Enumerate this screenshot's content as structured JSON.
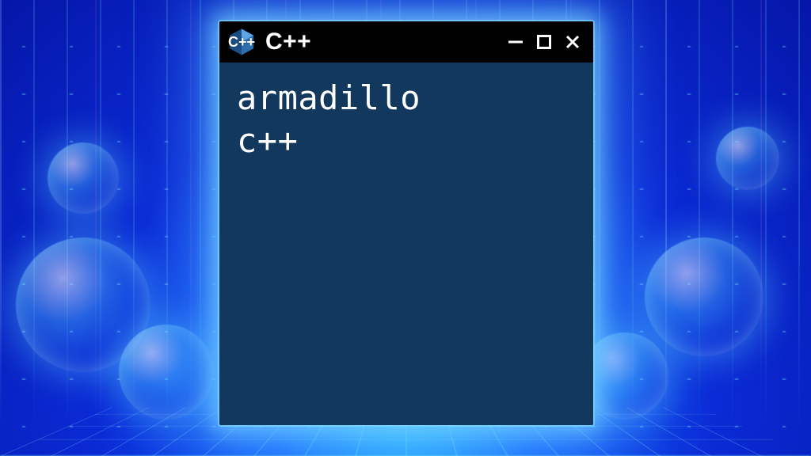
{
  "window": {
    "title": "C++",
    "icon": {
      "symbol": "C++",
      "semantic": "cpp-logo"
    },
    "controls": {
      "minimize": "minimize",
      "maximize": "maximize",
      "close": "close"
    }
  },
  "content": {
    "line1": "armadillo",
    "line2": "c++"
  },
  "colors": {
    "titlebar_bg": "#000000",
    "client_bg": "#12385e",
    "glow": "#6fd8ff",
    "text": "#ffffff",
    "badge_light": "#5aa6e6",
    "badge_dark": "#1a4e84"
  }
}
